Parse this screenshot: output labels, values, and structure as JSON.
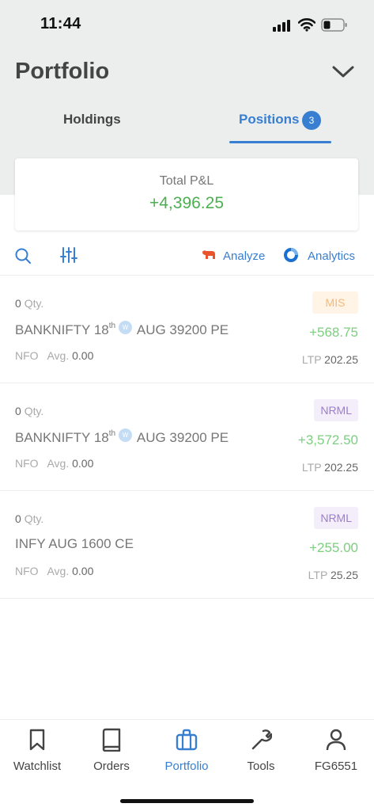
{
  "status_bar": {
    "time": "11:44"
  },
  "header": {
    "title": "Portfolio"
  },
  "tabs": {
    "holdings_label": "Holdings",
    "positions_label": "Positions",
    "positions_count": "3"
  },
  "summary": {
    "label": "Total P&L",
    "value": "+4,396.25"
  },
  "toolbar": {
    "analyze_label": "Analyze",
    "analytics_label": "Analytics"
  },
  "positions": [
    {
      "qty": "0",
      "qty_unit": "Qty.",
      "symbol_main": "BANKNIFTY 18",
      "symbol_sup": "th",
      "weekly_badge": "W",
      "symbol_rest": "AUG 39200 PE",
      "exchange": "NFO",
      "avg_label": "Avg.",
      "avg_value": "0.00",
      "product": "MIS",
      "pnl": "+568.75",
      "ltp_label": "LTP",
      "ltp_value": "202.25"
    },
    {
      "qty": "0",
      "qty_unit": "Qty.",
      "symbol_main": "BANKNIFTY 18",
      "symbol_sup": "th",
      "weekly_badge": "W",
      "symbol_rest": "AUG 39200 PE",
      "exchange": "NFO",
      "avg_label": "Avg.",
      "avg_value": "0.00",
      "product": "NRML",
      "pnl": "+3,572.50",
      "ltp_label": "LTP",
      "ltp_value": "202.25"
    },
    {
      "qty": "0",
      "qty_unit": "Qty.",
      "symbol_main": "INFY AUG 1600 CE",
      "exchange": "NFO",
      "avg_label": "Avg.",
      "avg_value": "0.00",
      "product": "NRML",
      "pnl": "+255.00",
      "ltp_label": "LTP",
      "ltp_value": "25.25"
    }
  ],
  "bottom_nav": [
    {
      "label": "Watchlist",
      "icon": "bookmark-icon"
    },
    {
      "label": "Orders",
      "icon": "book-icon"
    },
    {
      "label": "Portfolio",
      "icon": "briefcase-icon",
      "active": true
    },
    {
      "label": "Tools",
      "icon": "wrench-icon"
    },
    {
      "label": "FG6551",
      "icon": "user-icon"
    }
  ],
  "colors": {
    "accent": "#387ed1",
    "profit": "#4caf50",
    "mis_badge": "#f5b97a",
    "nrml_badge": "#9d7cd2"
  }
}
